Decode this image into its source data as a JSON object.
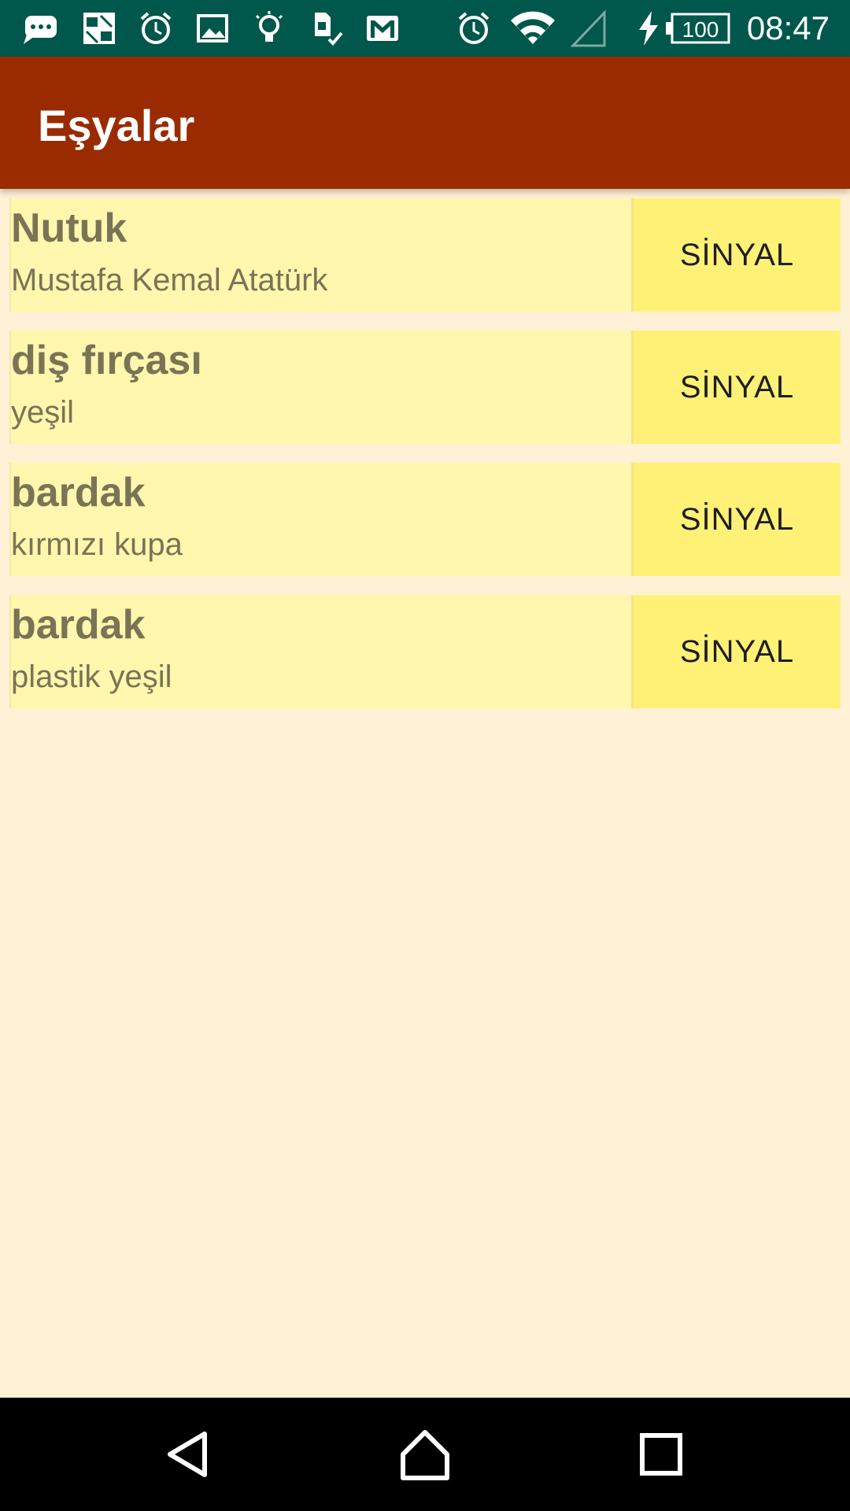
{
  "status_bar": {
    "time": "08:47",
    "battery_level": "100",
    "icons": [
      "message-icon",
      "app-icon",
      "alarm-outline-icon",
      "image-icon",
      "bulb-icon",
      "sim-check-icon",
      "gmail-icon",
      "alarm-icon",
      "wifi-icon",
      "cell-signal-icon",
      "charging-icon",
      "battery-icon"
    ]
  },
  "app_bar": {
    "title": "Eşyalar",
    "color": "#9A2B00"
  },
  "items": [
    {
      "name": "Nutuk",
      "description": "Mustafa Kemal Atatürk",
      "button_label": "SİNYAL"
    },
    {
      "name": "diş fırçası",
      "description": "yeşil",
      "button_label": "SİNYAL"
    },
    {
      "name": "bardak",
      "description": "kırmızı kupa",
      "button_label": "SİNYAL"
    },
    {
      "name": "bardak",
      "description": "plastik yeşil",
      "button_label": "SİNYAL"
    }
  ],
  "nav_bar": {
    "icons": [
      "back-icon",
      "home-icon",
      "recents-icon"
    ]
  },
  "colors": {
    "background": "#FFF1D6",
    "row": "#FFF7AE",
    "button": "#FFF176",
    "status_bar": "#00574B"
  }
}
